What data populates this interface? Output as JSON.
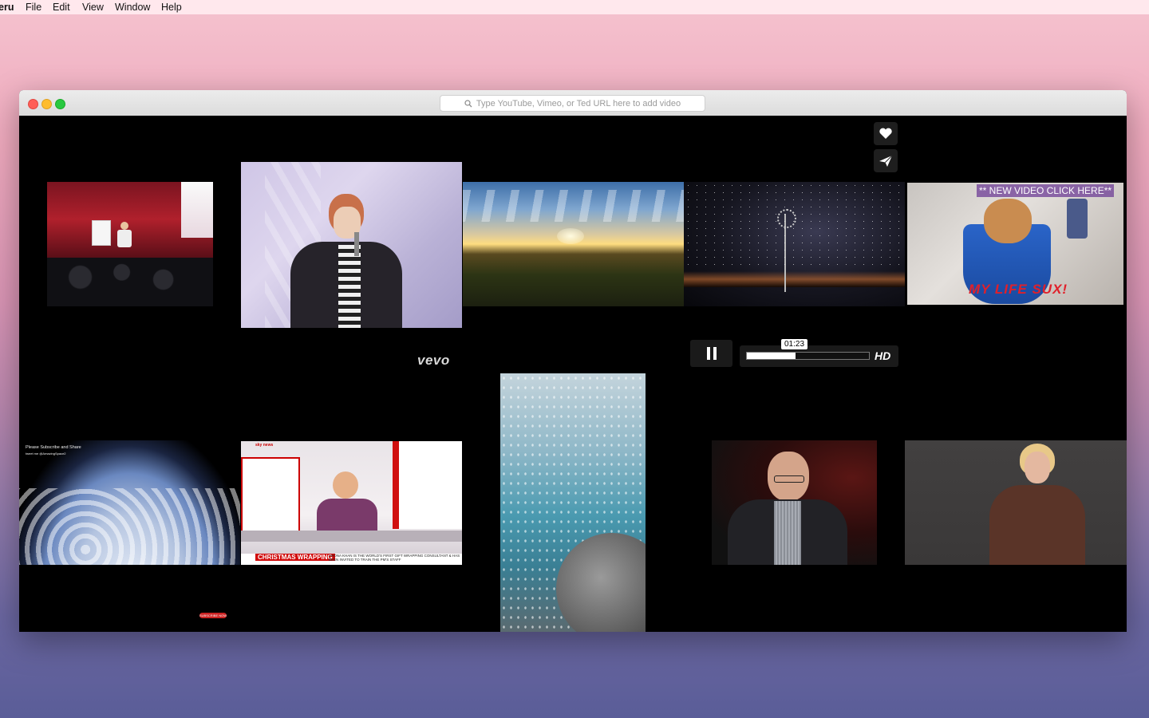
{
  "menubar": {
    "app_name": "eru",
    "items": [
      "File",
      "Edit",
      "View",
      "Window",
      "Help"
    ]
  },
  "window": {
    "url_placeholder": "Type YouTube, Vimeo, or Ted URL here to add video",
    "traffic_lights": {
      "close": "#ff5f57",
      "minimize": "#febc2e",
      "zoom": "#28c840"
    }
  },
  "actions": {
    "favorite_icon": "heart-icon",
    "share_icon": "paper-plane-icon"
  },
  "player": {
    "time": "01:23",
    "progress": 0.4,
    "quality": "HD",
    "pause_icon": "pause-icon"
  },
  "overlays": {
    "vevo": "vevo",
    "kitten_banner": "** NEW VIDEO CLICK HERE**",
    "kitten_caption": "MY LIFE SUX!",
    "earth_caption": "Please Subscribe and Share",
    "earth_subcaption": "tweet me @AmazingSpace2",
    "subscribe_button": "SUBSCRIBE NOW",
    "news_headline": "CHRISTMAS WRAPPING",
    "news_ticker": "ARONA KHAN IS THE WORLD'S FIRST GIFT WRAPPING CONSULTANT & HAS BEEN INVITED TO TRAIN THE PM'S STAFF",
    "news_logo": "sky news"
  }
}
